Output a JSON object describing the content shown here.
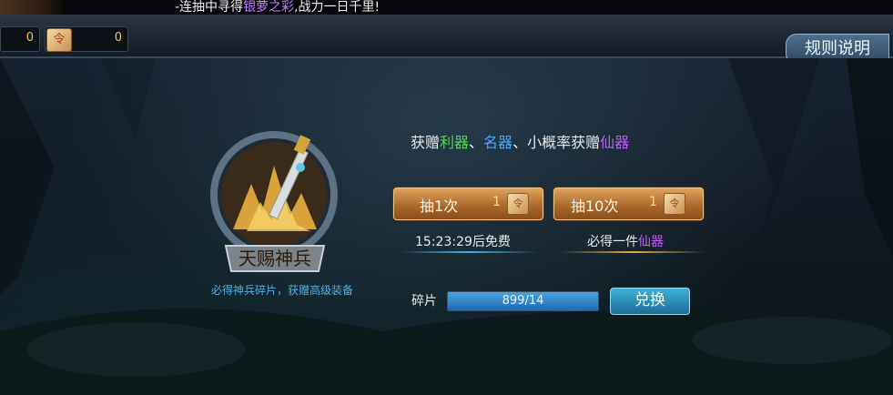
{
  "ticker": {
    "prefix": "-连抽中寻得",
    "highlight": "银萝之彩",
    "suffix": ",战力一日千里!"
  },
  "currency": [
    {
      "value": "0",
      "icon": "ticket-icon"
    },
    {
      "value": "0",
      "icon": "scroll-icon",
      "glyph": "令"
    }
  ],
  "rules_button": "规则说明",
  "emblem": {
    "title": "天赐神兵",
    "caption": "必得神兵碎片，获赠高级装备"
  },
  "intro": {
    "p1": "获赠",
    "g": "利器",
    "sep1": "、",
    "b": "名器",
    "sep2": "、",
    "p2": "小概率获赠",
    "p": "仙器"
  },
  "draw_one": {
    "label": "抽1次",
    "count": "1",
    "glyph": "令",
    "sub": "15:23:29后免费"
  },
  "draw_ten": {
    "label": "抽10次",
    "count": "1",
    "glyph": "令",
    "sub_prefix": "必得一件",
    "sub_highlight": "仙器"
  },
  "shards": {
    "label": "碎片",
    "text": "899/14",
    "fill": 1.0
  },
  "exchange_button": "兑换",
  "colors": {
    "green": "#4fdb4a",
    "blue": "#4aa8ff",
    "purple": "#c25cff",
    "gold": "#ffe07a",
    "caption": "#4fb2e6"
  }
}
